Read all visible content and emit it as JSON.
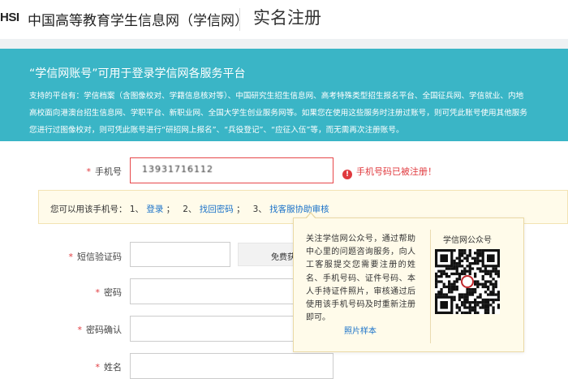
{
  "header": {
    "logo_text": "HSI",
    "site_name": "中国高等教育学生信息网（学信网）",
    "page_title": "实名注册"
  },
  "banner": {
    "title": "“学信网账号”可用于登录学信网各服务平台",
    "desc_line1": "支持的平台有：学信档案（含图像校对、学籍信息核对等）、中国研究生招生信息网、高考特殊类型招生报名平台、全国征兵网、学信就业、内地",
    "desc_line2": "高校面向港澳台招生信息网、学职平台、新职业网、全国大学生创业服务网等。如果您在使用这些服务时注册过账号，则可凭此账号使用其他服务",
    "desc_line3": "您进行过图像校对，则可凭此账号进行“研招网上报名”、“兵役登记”、“应征入伍”等，而无需再次注册账号。"
  },
  "form": {
    "phone": {
      "label": "手机号",
      "value": "13931716112"
    },
    "phone_error": "手机号码已被注册！",
    "notice": {
      "prefix": "您可以用该手机号：",
      "n1": "1、",
      "login": "登录",
      "sep1": "；",
      "n2": "2、",
      "recover": "找回密码",
      "sep2": "；",
      "n3": "3、",
      "support": "找客服协助审核"
    },
    "sms": {
      "label": "短信验证码",
      "button": "免费获取"
    },
    "password": {
      "label": "密码"
    },
    "password_confirm": {
      "label": "密码确认"
    },
    "name": {
      "label": "姓名"
    }
  },
  "popover": {
    "text": "关注学信网公众号，通过帮助中心里的问题咨询服务，向人工客服提交您需要注册的姓名、手机号码、证件号码、本人手持证件照片，审核通过后使用该手机号码及时重新注册即可。",
    "link": "照片样本",
    "qr_label": "学信网公众号"
  }
}
